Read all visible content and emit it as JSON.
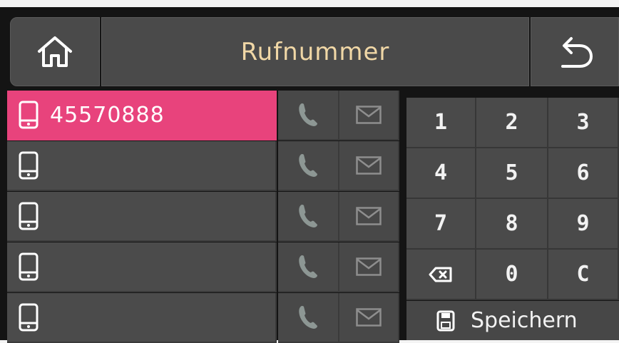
{
  "header": {
    "title": "Rufnummer",
    "home_icon": "home-icon",
    "back_icon": "back-arrow-icon"
  },
  "entries": [
    {
      "number": "45570888",
      "active": true
    },
    {
      "number": "",
      "active": false
    },
    {
      "number": "",
      "active": false
    },
    {
      "number": "",
      "active": false
    },
    {
      "number": "",
      "active": false
    }
  ],
  "keypad": {
    "keys": [
      "1",
      "2",
      "3",
      "4",
      "5",
      "6",
      "7",
      "8",
      "9",
      "⌫",
      "0",
      "C"
    ],
    "save_label": "Speichern"
  },
  "colors": {
    "accent": "#e8437c",
    "title_text": "#f0d7a6",
    "panel": "#4a4a4a"
  }
}
